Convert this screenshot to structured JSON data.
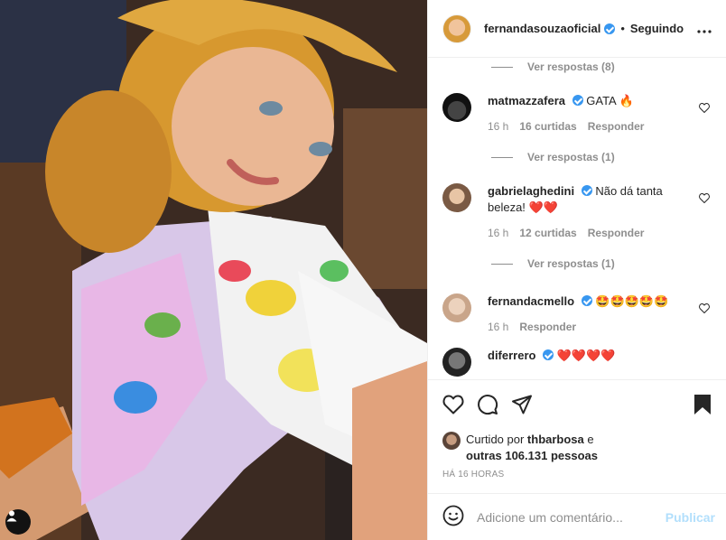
{
  "post": {
    "author": "fernandasouzaoficial",
    "separator": "•",
    "follow_status": "Seguindo",
    "more_label": "•••"
  },
  "comments": [
    {
      "replies_label": "Ver respostas (8)"
    },
    {
      "username": "matmazzafera",
      "text": "GATA 🔥",
      "time": "16 h",
      "likes": "16 curtidas",
      "reply": "Responder",
      "replies_label": "Ver respostas (1)"
    },
    {
      "username": "gabrielaghedini",
      "text": "Não dá tanta beleza! ❤️❤️",
      "time": "16 h",
      "likes": "12 curtidas",
      "reply": "Responder",
      "replies_label": "Ver respostas (1)"
    },
    {
      "username": "fernandacmello",
      "text": "🤩🤩🤩🤩🤩",
      "time": "16 h",
      "reply": "Responder"
    },
    {
      "username": "diferrero",
      "text": "❤️❤️❤️❤️"
    }
  ],
  "likes": {
    "prefix": "Curtido por ",
    "user": "thbarbosa",
    "middle": " e",
    "others": "outras 106.131 pessoas"
  },
  "timeago": "HÁ 16 HORAS",
  "add_comment": {
    "placeholder": "Adicione um comentário...",
    "publish": "Publicar"
  },
  "colors": {
    "accent": "#3897f0",
    "publish_disabled": "#b2dffc",
    "muted": "#8e8e8e",
    "border": "#efefef"
  },
  "icons": [
    "heart-icon",
    "comment-icon",
    "share-icon",
    "bookmark-icon",
    "emoji-icon",
    "user-tag-icon",
    "more-icon",
    "verified-icon"
  ]
}
